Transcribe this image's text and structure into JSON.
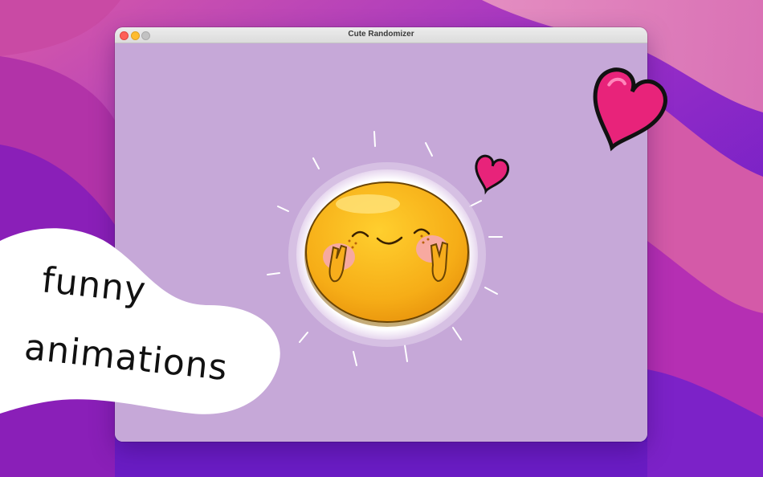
{
  "window": {
    "title": "Cute Randomizer"
  },
  "promo": {
    "line1": "funny",
    "line2": "animations"
  },
  "colors": {
    "window_background": "#c6a8d8",
    "sun_fill": "#f9b51b",
    "heart_fill": "#e8237a",
    "wallpaper_accent": "#7a2fd0"
  },
  "icons": [
    "close-icon",
    "minimize-icon",
    "zoom-icon",
    "sun-character-icon",
    "heart-icon"
  ]
}
